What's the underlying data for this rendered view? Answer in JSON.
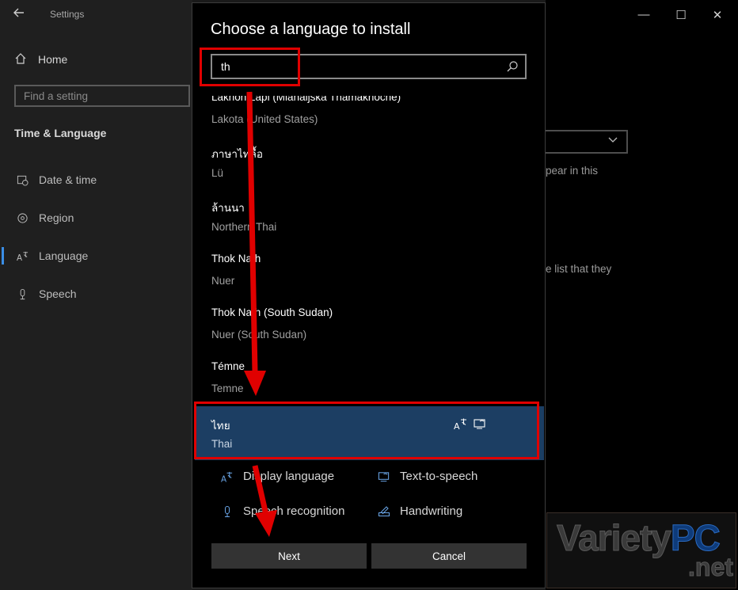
{
  "window": {
    "title": "Settings",
    "controls": {
      "minimize": "—",
      "maximize": "☐",
      "close": "✕"
    }
  },
  "sidebar": {
    "home_label": "Home",
    "search_placeholder": "Find a setting",
    "section_title": "Time & Language",
    "items": [
      {
        "label": "Date & time",
        "icon": "calendar-clock-icon"
      },
      {
        "label": "Region",
        "icon": "globe-icon"
      },
      {
        "label": "Language",
        "icon": "language-icon",
        "selected": true
      },
      {
        "label": "Speech",
        "icon": "microphone-icon"
      }
    ]
  },
  "background": {
    "text_1": "pear in this",
    "text_2": "e list that they"
  },
  "dialog": {
    "title": "Choose a language to install",
    "search_value": "th",
    "languages": [
      {
        "native": "Lakhon Lapi (Mlanaijska Thamakhoche)",
        "english": "Lakota (United States)"
      },
      {
        "native": "ภาษาไทลื้อ",
        "english": "Lü"
      },
      {
        "native": "ล้านนา",
        "english": "Northern Thai"
      },
      {
        "native": "Thok Nath",
        "english": "Nuer"
      },
      {
        "native": "Thok Nath (South Sudan)",
        "english": "Nuer (South Sudan)"
      },
      {
        "native": "Témne",
        "english": "Temne"
      }
    ],
    "selected": {
      "native": "ไทย",
      "english": "Thai"
    },
    "features": [
      {
        "label": "Display language",
        "icon": "display-language-icon"
      },
      {
        "label": "Text-to-speech",
        "icon": "text-to-speech-icon"
      },
      {
        "label": "Speech recognition",
        "icon": "microphone-icon"
      },
      {
        "label": "Handwriting",
        "icon": "handwriting-icon"
      }
    ],
    "next_label": "Next",
    "cancel_label": "Cancel"
  },
  "watermark": {
    "main": "Variety",
    "accent": "PC",
    "sub": ".net"
  },
  "colors": {
    "accent": "#3a8ee6",
    "selection": "#1c3e63",
    "annotation": "#e00000"
  }
}
